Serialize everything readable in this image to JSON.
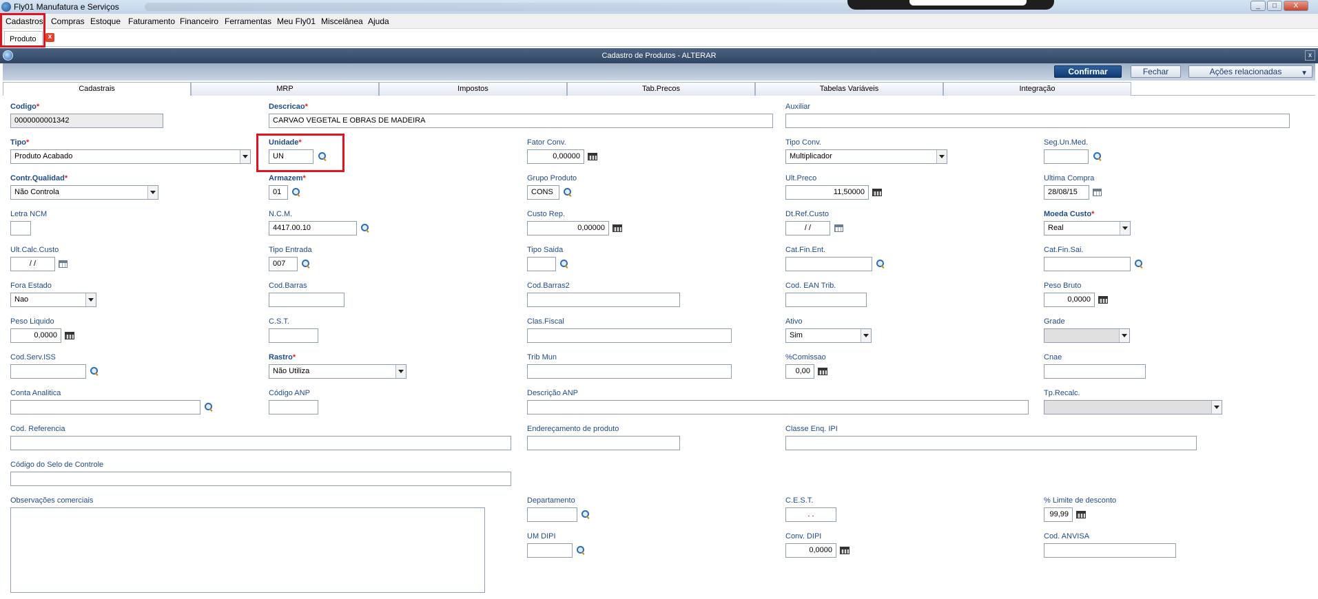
{
  "window": {
    "title": "Fly01 Manufatura e Serviços",
    "min": "_",
    "max": "□",
    "close": "X"
  },
  "menu": [
    "Cadastros",
    "Compras",
    "Estoque",
    "Faturamento",
    "Financeiro",
    "Ferramentas",
    "Meu Fly01",
    "Miscelânea",
    "Ajuda"
  ],
  "doc_tab": {
    "label": "Produto",
    "close": "x"
  },
  "header": {
    "title": "Cadastro de Produtos - ALTERAR",
    "close": "x"
  },
  "toolbar": {
    "confirm": "Confirmar",
    "close": "Fechar",
    "actions": "Ações relacionadas",
    "actions_arrow": "▼"
  },
  "tabs": [
    "Cadastrais",
    "MRP",
    "Impostos",
    "Tab.Precos",
    "Tabelas Variáveis",
    "Integração"
  ],
  "fields": {
    "codigo": {
      "label": "Codigo",
      "value": "0000000001342"
    },
    "descricao": {
      "label": "Descricao",
      "value": "CARVAO VEGETAL E OBRAS DE MADEIRA"
    },
    "auxiliar": {
      "label": "Auxiliar",
      "value": ""
    },
    "tipo": {
      "label": "Tipo",
      "value": "Produto Acabado"
    },
    "unidade": {
      "label": "Unidade",
      "value": "UN"
    },
    "fator_conv": {
      "label": "Fator Conv.",
      "value": "0,00000"
    },
    "tipo_conv": {
      "label": "Tipo Conv.",
      "value": "Multiplicador"
    },
    "seg_un_med": {
      "label": "Seg.Un.Med.",
      "value": ""
    },
    "contr_qualidade": {
      "label": "Contr.Qualidad",
      "value": "Não Controla"
    },
    "armazem": {
      "label": "Armazem",
      "value": "01"
    },
    "grupo_produto": {
      "label": "Grupo Produto",
      "value": "CONS"
    },
    "ult_preco": {
      "label": "Ult.Preco",
      "value": "11,50000"
    },
    "ultima_compra": {
      "label": "Ultima Compra",
      "value": "28/08/15"
    },
    "letra_ncm": {
      "label": "Letra NCM",
      "value": ""
    },
    "ncm": {
      "label": "N.C.M.",
      "value": "4417.00.10"
    },
    "custo_rep": {
      "label": "Custo Rep.",
      "value": "0,00000"
    },
    "dt_ref_custo": {
      "label": "Dt.Ref.Custo",
      "value": "/ /"
    },
    "moeda_custo": {
      "label": "Moeda Custo",
      "value": "Real"
    },
    "ult_calc_custo": {
      "label": "Ult.Calc.Custo",
      "value": "/ /"
    },
    "tipo_entrada": {
      "label": "Tipo Entrada",
      "value": "007"
    },
    "tipo_saida": {
      "label": "Tipo Saida",
      "value": ""
    },
    "cat_fin_ent": {
      "label": "Cat.Fin.Ent.",
      "value": ""
    },
    "cat_fin_sai": {
      "label": "Cat.Fin.Sai.",
      "value": ""
    },
    "fora_estado": {
      "label": "Fora Estado",
      "value": "Nao"
    },
    "cod_barras": {
      "label": "Cod.Barras",
      "value": ""
    },
    "cod_barras2": {
      "label": "Cod.Barras2",
      "value": ""
    },
    "cod_ean_trib": {
      "label": "Cod. EAN Trib.",
      "value": ""
    },
    "peso_bruto": {
      "label": "Peso Bruto",
      "value": "0,0000"
    },
    "peso_liquido": {
      "label": "Peso Liquido",
      "value": "0,0000"
    },
    "cst": {
      "label": "C.S.T.",
      "value": ""
    },
    "clas_fiscal": {
      "label": "Clas.Fiscal",
      "value": ""
    },
    "ativo": {
      "label": "Ativo",
      "value": "Sim"
    },
    "grade": {
      "label": "Grade",
      "value": ""
    },
    "cod_serv_iss": {
      "label": "Cod.Serv.ISS",
      "value": ""
    },
    "rastro": {
      "label": "Rastro",
      "value": "Não Utiliza"
    },
    "trib_mun": {
      "label": "Trib Mun",
      "value": ""
    },
    "comissao": {
      "label": "%Comissao",
      "value": "0,00"
    },
    "cnae": {
      "label": "Cnae",
      "value": ""
    },
    "conta_analitica": {
      "label": "Conta Analitica",
      "value": ""
    },
    "codigo_anp": {
      "label": "Código ANP",
      "value": ""
    },
    "descricao_anp": {
      "label": "Descrição ANP",
      "value": ""
    },
    "tp_recalc": {
      "label": "Tp.Recalc.",
      "value": ""
    },
    "cod_referencia": {
      "label": "Cod. Referencia",
      "value": ""
    },
    "enderecamento": {
      "label": "Endereçamento de produto",
      "value": ""
    },
    "classe_enq_ipi": {
      "label": "Classe Enq. IPI",
      "value": ""
    },
    "codigo_selo": {
      "label": "Código do Selo de Controle",
      "value": ""
    },
    "obs_comerciais": {
      "label": "Observações comerciais",
      "value": ""
    },
    "departamento": {
      "label": "Departamento",
      "value": ""
    },
    "cest": {
      "label": "C.E.S.T.",
      "value": ". ."
    },
    "limite_desconto": {
      "label": "% Limite de desconto",
      "value": "99,99"
    },
    "um_dipi": {
      "label": "UM DIPI",
      "value": ""
    },
    "conv_dipi": {
      "label": "Conv. DIPI",
      "value": "0,0000"
    },
    "cod_anvisa": {
      "label": "Cod. ANVISA",
      "value": ""
    }
  },
  "required_mark": "*",
  "accent": {
    "header": "#2f4562",
    "label": "#1f4b87",
    "required": "#e02020",
    "highlight": "#e0141e"
  }
}
